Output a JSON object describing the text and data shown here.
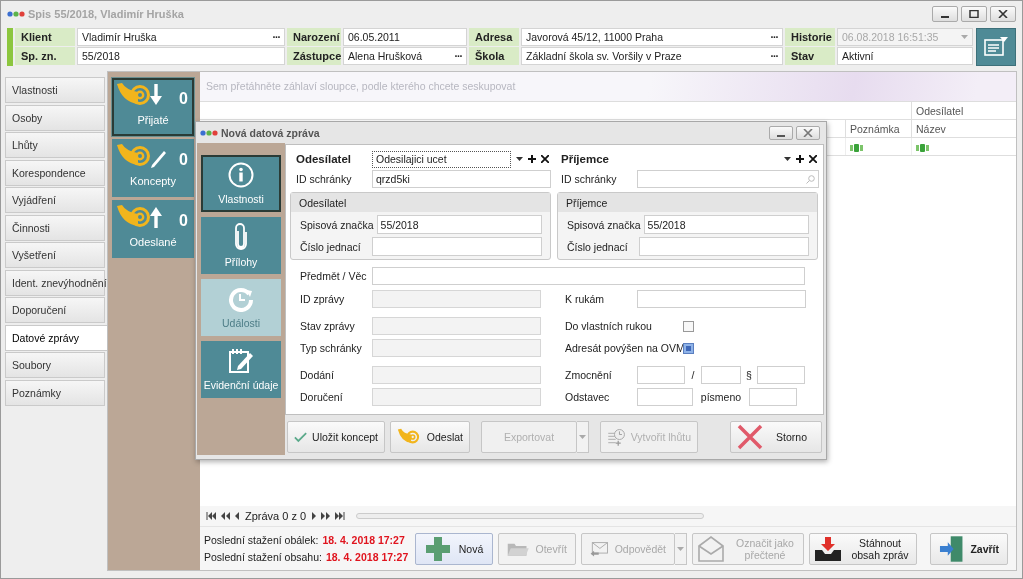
{
  "window": {
    "title": "Spis 55/2018, Vladimír Hruška"
  },
  "header": {
    "fields": [
      {
        "label": "Klient",
        "value": "Vladimír Hruška",
        "more": "···"
      },
      {
        "label": "Narození",
        "value": "06.05.2011"
      },
      {
        "label": "Adresa",
        "value": "Javorová 45/12, 11000 Praha",
        "more": "···"
      },
      {
        "label": "Historie",
        "value": "06.08.2018 16:51:35",
        "disabled": true,
        "dropdown": true
      },
      {
        "label": "Sp. zn.",
        "value": "55/2018"
      },
      {
        "label": "Zástupce",
        "value": "Alena Hrušková",
        "more": "···"
      },
      {
        "label": "Škola",
        "value": "Základní škola sv. Voršily v Praze",
        "more": "···"
      },
      {
        "label": "Stav",
        "value": "Aktivní",
        "disabled": false
      }
    ]
  },
  "sidebar": {
    "items": [
      {
        "label": "Vlastnosti",
        "selected": false
      },
      {
        "label": "Osoby",
        "selected": false
      },
      {
        "label": "Lhůty",
        "selected": false
      },
      {
        "label": "Korespondence",
        "selected": false
      },
      {
        "label": "Vyjádření",
        "selected": false
      },
      {
        "label": "Činnosti",
        "selected": false
      },
      {
        "label": "Vyšetření",
        "selected": false
      },
      {
        "label": "Ident. znevýhodnění",
        "selected": false
      },
      {
        "label": "Doporučení",
        "selected": false
      },
      {
        "label": "Datové zprávy",
        "selected": true
      },
      {
        "label": "Soubory",
        "selected": false
      },
      {
        "label": "Poznámky",
        "selected": false
      }
    ]
  },
  "mailboxes": [
    {
      "kind": "in",
      "label": "Přijaté",
      "count": "0",
      "selected": true
    },
    {
      "kind": "draft",
      "label": "Koncepty",
      "count": "0",
      "selected": false
    },
    {
      "kind": "out",
      "label": "Odeslané",
      "count": "0",
      "selected": false
    }
  ],
  "grid": {
    "group_hint": "Sem přetáhněte záhlaví sloupce, podle kterého chcete seskupovat",
    "columns": [
      {
        "label": "Poznámka"
      },
      {
        "label": "Název",
        "group": "Odesílatel"
      }
    ]
  },
  "navigator": {
    "text": "Zpráva 0 z 0"
  },
  "status": [
    {
      "label": "Poslední stažení obálek:",
      "value": "18. 4. 2018 17:27"
    },
    {
      "label": "Poslední stažení obsahu:",
      "value": "18. 4. 2018 17:27"
    }
  ],
  "buttons": [
    {
      "kind": "plus",
      "label": "Nová",
      "disabled": false
    },
    {
      "kind": "folder",
      "label": "Otevřít",
      "disabled": true
    },
    {
      "kind": "reply",
      "label": "Odpovědět",
      "disabled": true,
      "dropdown": true
    },
    {
      "kind": "envelope",
      "label": "Označit jako přečtené",
      "disabled": true
    },
    {
      "kind": "download",
      "label": "Stáhnout obsah zpráv",
      "disabled": false
    },
    {
      "kind": "exit",
      "label": "Zavřít",
      "disabled": false,
      "bold": true
    }
  ],
  "dialog": {
    "title": "Nová datová zpráva",
    "tabs": [
      {
        "kind": "info",
        "label": "Vlastnosti",
        "selected": true,
        "disabled": false
      },
      {
        "kind": "clip",
        "label": "Přílohy",
        "selected": false,
        "disabled": false
      },
      {
        "kind": "events",
        "label": "Události",
        "selected": false,
        "disabled": true
      },
      {
        "kind": "note",
        "label": "Evidenční údaje",
        "selected": false,
        "disabled": false
      }
    ],
    "parties": [
      {
        "label": "Odesílatel",
        "value": "Odesilajici ucet",
        "id_label": "ID schránky",
        "id_value": "qrzd5ki"
      },
      {
        "label": "Příjemce",
        "id_label": "ID schránky",
        "search": true
      }
    ],
    "groups": [
      {
        "title": "Odesílatel",
        "fields": [
          {
            "label": "Spisová značka",
            "value": "55/2018"
          },
          {
            "label": "Číslo jednací"
          }
        ]
      },
      {
        "title": "Příjemce",
        "fields": [
          {
            "label": "Spisová značka",
            "value": "55/2018"
          },
          {
            "label": "Číslo jednací"
          }
        ]
      }
    ],
    "subject": {
      "label": "Předmět / Věc"
    },
    "rows": [
      {
        "label": "ID zprávy",
        "disabled": true,
        "right": {
          "kind": "field",
          "label": "K rukám"
        }
      },
      {
        "label": "Stav zprávy",
        "disabled": true,
        "right": {
          "kind": "checkbox",
          "label": "Do vlastních rukou",
          "checked": false
        }
      },
      {
        "label": "Typ schránky",
        "disabled": true,
        "right": {
          "kind": "checkbox",
          "label": "Adresát povýšen na OVM",
          "checked": true
        }
      },
      {
        "label": "Dodání",
        "disabled": true,
        "right": {
          "kind": "triple",
          "label": "Zmocnění",
          "separators": [
            "/",
            "§"
          ]
        }
      },
      {
        "label": "Doručení",
        "disabled": true,
        "right": {
          "kind": "pair",
          "label": "Odstavec",
          "separators": [
            "písmeno"
          ]
        }
      }
    ],
    "buttons": [
      {
        "kind": "check",
        "label": "Uložit koncept",
        "disabled": false
      },
      {
        "kind": "horn",
        "label": "Odeslat",
        "disabled": false
      },
      {
        "kind": "none",
        "label": "Exportovat",
        "disabled": true,
        "dropdown": true
      },
      {
        "kind": "clock",
        "label": "Vytvořit lhůtu",
        "disabled": true
      },
      {
        "kind": "cross",
        "label": "Storno",
        "disabled": false
      }
    ]
  }
}
